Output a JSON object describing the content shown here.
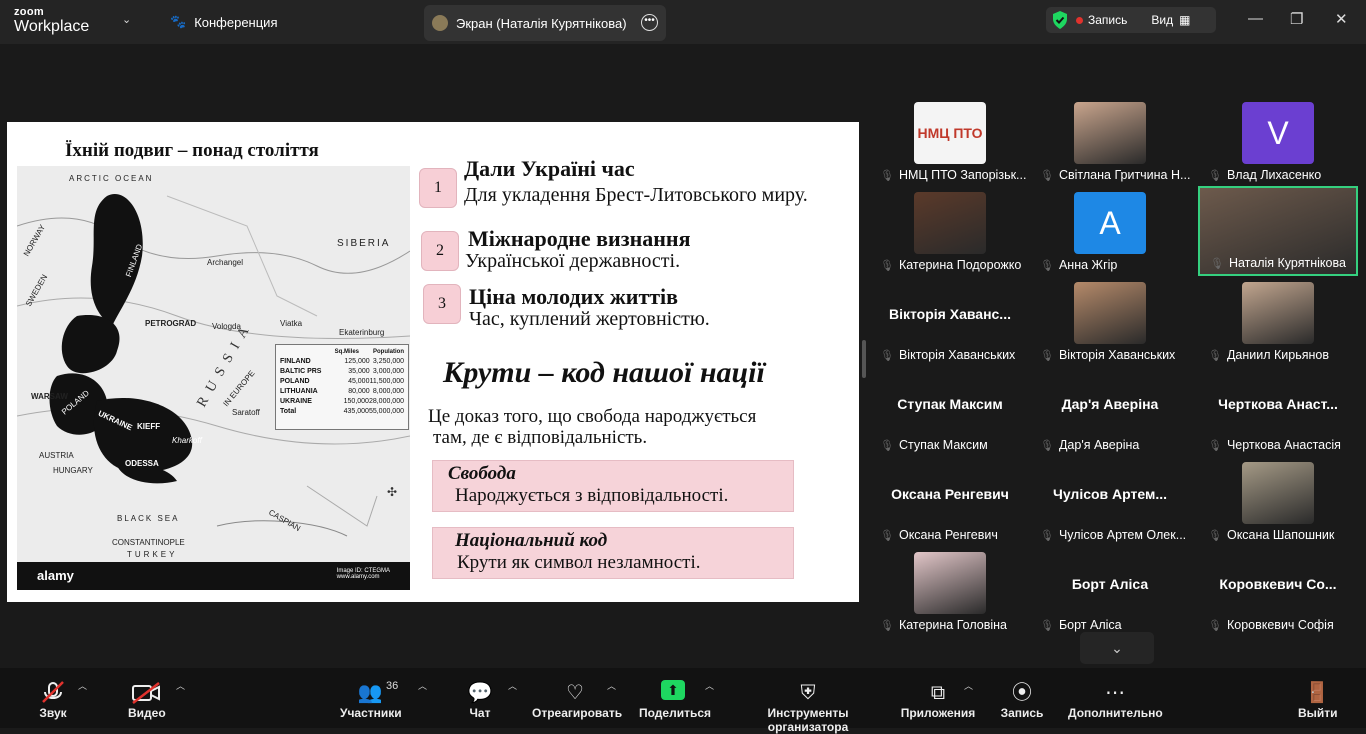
{
  "app": {
    "logo_line1": "zoom",
    "logo_line2": "Workplace",
    "conference_label": "Конференция",
    "tab_label": "Экран (Наталія Курятнікова)",
    "record_label": "Запись",
    "view_label": "Вид"
  },
  "slide": {
    "map_title": "Їхній подвиг – понад століття",
    "map_labels": {
      "arctic": "ARCTIC OCEAN",
      "siberia": "SIBERIA",
      "finland": "FINLAND",
      "archangel": "Archangel",
      "petrograd": "PETROGRAD",
      "vologda": "Vologda",
      "viatka": "Viatka",
      "ekaterinburg": "Ekaterinburg",
      "sweden": "SWEDEN",
      "norway": "NORWAY",
      "russia": "RUSSIA",
      "in_europe": "IN EUROPE",
      "ukraine": "UKRAINE",
      "poland": "POLAND",
      "warsaw": "WARSAW",
      "austria": "AUSTRIA",
      "hungary": "HUNGARY",
      "odessa": "ODESSA",
      "kieff": "KIEFF",
      "kharkoff": "Kharkoff",
      "saratoff": "Saratoff",
      "black_sea": "BLACK SEA",
      "caspian": "CASPIAN",
      "constantinople": "CONSTANTINOPLE",
      "turkey": "TURKEY",
      "brand": "alamy",
      "brand_id": "Image ID: CTEGMA",
      "brand_url": "www.alamy.com"
    },
    "pop_table": {
      "headers": [
        "Sq.Miles",
        "Population"
      ],
      "rows": [
        [
          "FINLAND",
          "125,000",
          "3,250,000"
        ],
        [
          "BALTIC PRS",
          "35,000",
          "3,000,000"
        ],
        [
          "POLAND",
          "45,000",
          "11,500,000"
        ],
        [
          "LITHUANIA",
          "80,000",
          "8,000,000"
        ],
        [
          "UKRAINE",
          "150,000",
          "28,000,000"
        ],
        [
          "Total",
          "435,000",
          "55,000,000"
        ]
      ]
    },
    "items": [
      {
        "num": "1",
        "head": "Дали Україні час",
        "sub": "Для укладення Брест-Литовського миру."
      },
      {
        "num": "2",
        "head": "Міжнародне визнання",
        "sub": "Української державності."
      },
      {
        "num": "3",
        "head": "Ціна молодих життів",
        "sub": "Час, куплений жертовністю."
      }
    ],
    "big_title": "Крути – код нашої нації",
    "statement_l1": "Це доказ того, що свобода народжується",
    "statement_l2": "там, де є відповідальність.",
    "box1_title": "Свобода",
    "box1_text": "Народжується з відповідальності.",
    "box2_title": "Національний код",
    "box2_text": "Крути як символ незламності."
  },
  "participants": [
    {
      "label": "НМЦ ПТО Запорізьк...",
      "type": "logo",
      "logo_text": "НМЦ ПТО"
    },
    {
      "label": "Світлана Гритчина Н...",
      "type": "photo",
      "color": "#c9a58d"
    },
    {
      "label": "Влад Лихасенко",
      "type": "letter",
      "letter": "V",
      "color": "#6b3fd1"
    },
    {
      "label": "Катерина Подорожко",
      "type": "photo",
      "color": "#5b3a2a"
    },
    {
      "label": "Анна Жгір",
      "type": "letter",
      "letter": "A",
      "color": "#1e88e5"
    },
    {
      "label": "Наталія Курятнікова",
      "type": "active",
      "color": "#6d5a4c"
    },
    {
      "label": "Вікторія Хаванських",
      "type": "name",
      "big": "Вікторія Хаванс..."
    },
    {
      "label": "Вікторія Хаванських",
      "type": "photo",
      "color": "#b58a6a"
    },
    {
      "label": "Даниил Кирьянов",
      "type": "photo",
      "color": "#c2a68f"
    },
    {
      "label": "Ступак Максим",
      "type": "name",
      "big": "Ступак Максим"
    },
    {
      "label": "Дар'я Аверіна",
      "type": "name",
      "big": "Дар'я Аверіна"
    },
    {
      "label": "Черткова Анастасія",
      "type": "name",
      "big": "Черткова Анаст..."
    },
    {
      "label": "Оксана Ренгевич",
      "type": "name",
      "big": "Оксана Ренгевич"
    },
    {
      "label": "Чулісов Артем Олек...",
      "type": "name",
      "big": "Чулісов Артем..."
    },
    {
      "label": "Оксана Шапошник",
      "type": "photo",
      "color": "#a59a86"
    },
    {
      "label": "Катерина Головіна",
      "type": "photo",
      "color": "#e2c6c8"
    },
    {
      "label": "Борт Аліса",
      "type": "name",
      "big": "Борт Аліса"
    },
    {
      "label": "Коровкевич Софія",
      "type": "name",
      "big": "Коровкевич Со..."
    }
  ],
  "toolbar": {
    "audio": "Звук",
    "video": "Видео",
    "participants": "Участники",
    "participants_count": "36",
    "chat": "Чат",
    "react": "Отреагировать",
    "share": "Поделиться",
    "host_tools": "Инструменты организатора",
    "apps": "Приложения",
    "record": "Запись",
    "more": "Дополнительно",
    "leave": "Выйти"
  }
}
